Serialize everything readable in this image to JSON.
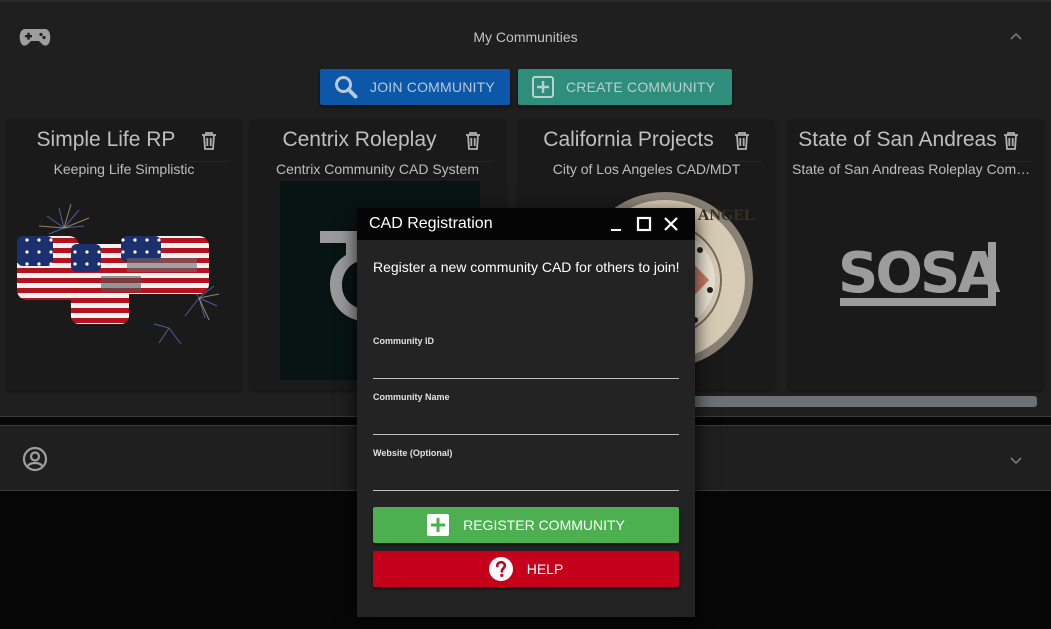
{
  "communities_panel": {
    "title": "My Communities",
    "join_label": "JOIN COMMUNITY",
    "create_label": "CREATE COMMUNITY",
    "cards": [
      {
        "title": "Simple Life RP",
        "subtitle": "Keeping Life Simplistic"
      },
      {
        "title": "Centrix Roleplay",
        "subtitle": "Centrix Community CAD System"
      },
      {
        "title": "California Projects",
        "subtitle": "City of Los Angeles CAD/MDT"
      },
      {
        "title": "State of San Andreas",
        "subtitle": "State of San Andreas Roleplay Community"
      }
    ],
    "logos": {
      "sosa": "SOSA"
    }
  },
  "dialog": {
    "title": "CAD Registration",
    "intro": "Register a new community CAD for others to join!",
    "fields": [
      {
        "label": "Community ID",
        "value": ""
      },
      {
        "label": "Community Name",
        "value": ""
      },
      {
        "label": "Website (Optional)",
        "value": ""
      }
    ],
    "register_label": "REGISTER COMMUNITY",
    "help_label": "HELP"
  },
  "colors": {
    "join": "#0c57a8",
    "create": "#2f8d7c",
    "register": "#4caf50",
    "help": "#c5001a"
  }
}
